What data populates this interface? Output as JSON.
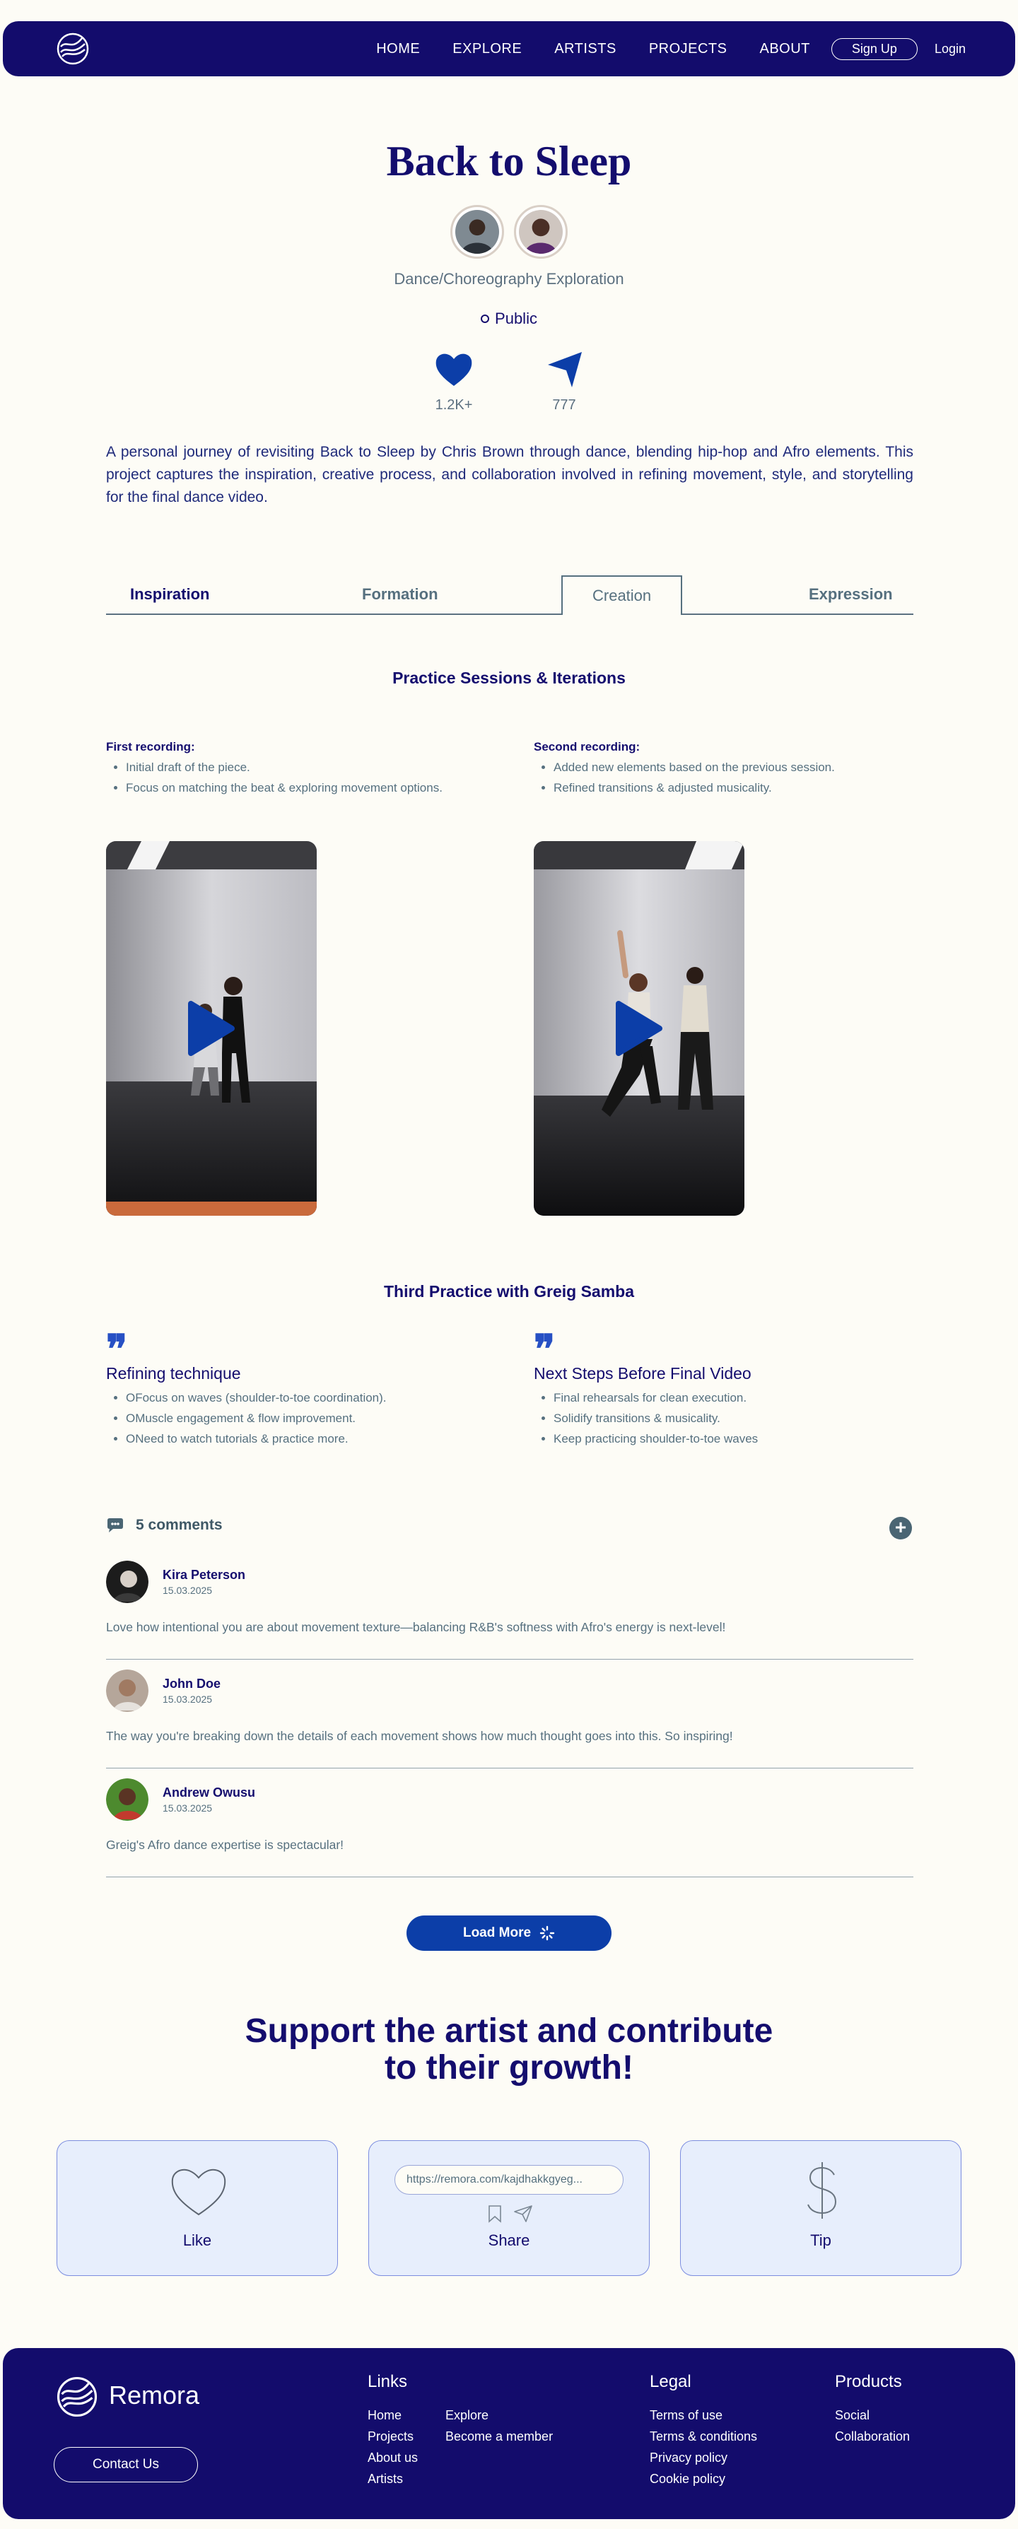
{
  "nav": {
    "links": [
      "HOME",
      "EXPLORE",
      "ARTISTS",
      "PROJECTS",
      "ABOUT"
    ],
    "signup": "Sign Up",
    "login": "Login"
  },
  "project": {
    "title": "Back to Sleep",
    "category": "Dance/Choreography Exploration",
    "visibility": "Public",
    "likes": "1.2K+",
    "shares": "777",
    "description": "A personal journey of revisiting Back to Sleep by Chris Brown through dance, blending hip-hop and Afro elements. This project captures the inspiration, creative process, and collaboration involved in refining movement, style, and storytelling for the final dance video."
  },
  "tabs": [
    "Inspiration",
    "Formation",
    "Creation",
    "Expression"
  ],
  "practice": {
    "heading": "Practice Sessions & Iterations",
    "first": {
      "title": "First recording:",
      "items": [
        "Initial draft of the piece.",
        "Focus on matching the beat & exploring movement options."
      ]
    },
    "second": {
      "title": "Second recording:",
      "items": [
        "Added new elements based on the previous session.",
        "Refined transitions & adjusted musicality."
      ]
    }
  },
  "third": {
    "heading": "Third Practice with Greig Samba",
    "left": {
      "title": "Refining technique",
      "items": [
        "OFocus on waves (shoulder-to-toe coordination).",
        "OMuscle engagement & flow improvement.",
        "ONeed to watch tutorials & practice more."
      ]
    },
    "right": {
      "title": "Next Steps Before Final  Video",
      "items": [
        "Final rehearsals for clean execution.",
        "Solidify transitions & musicality.",
        "Keep practicing shoulder-to-toe waves"
      ]
    }
  },
  "comments": {
    "count_label": "5 comments",
    "add_symbol": "+",
    "items": [
      {
        "name": "Kira Peterson",
        "date": "15.03.2025",
        "text": "Love how intentional you are about movement texture—balancing R&B's softness with Afro's energy is next-level!"
      },
      {
        "name": "John Doe",
        "date": "15.03.2025",
        "text": "The way you're breaking down the details of each movement shows how much thought goes into this. So inspiring!"
      },
      {
        "name": "Andrew Owusu",
        "date": "15.03.2025",
        "text": "Greig's Afro dance expertise is spectacular!"
      }
    ],
    "load_more": "Load More"
  },
  "support": {
    "title_line1": "Support the artist and contribute",
    "title_line2": "to their growth!",
    "like_label": "Like",
    "share_label": "Share",
    "share_url": "https://remora.com/kajdhakkgyeg...",
    "tip_label": "Tip"
  },
  "footer": {
    "brand": "Remora",
    "contact": "Contact Us",
    "links_title": "Links",
    "links_col1": [
      "Home",
      "Projects",
      "About us",
      "Artists"
    ],
    "links_col2": [
      "Explore",
      "Become a member"
    ],
    "legal_title": "Legal",
    "legal": [
      "Terms of use",
      "Terms & conditions",
      "Privacy policy",
      "Cookie policy"
    ],
    "products_title": "Products",
    "products": [
      "Social",
      "Collaboration"
    ]
  },
  "colors": {
    "navy": "#130c6c",
    "accent_blue": "#0c3ea8",
    "slate": "#56707f",
    "background": "#fdfcf6",
    "card_bg": "#e7eefc"
  }
}
